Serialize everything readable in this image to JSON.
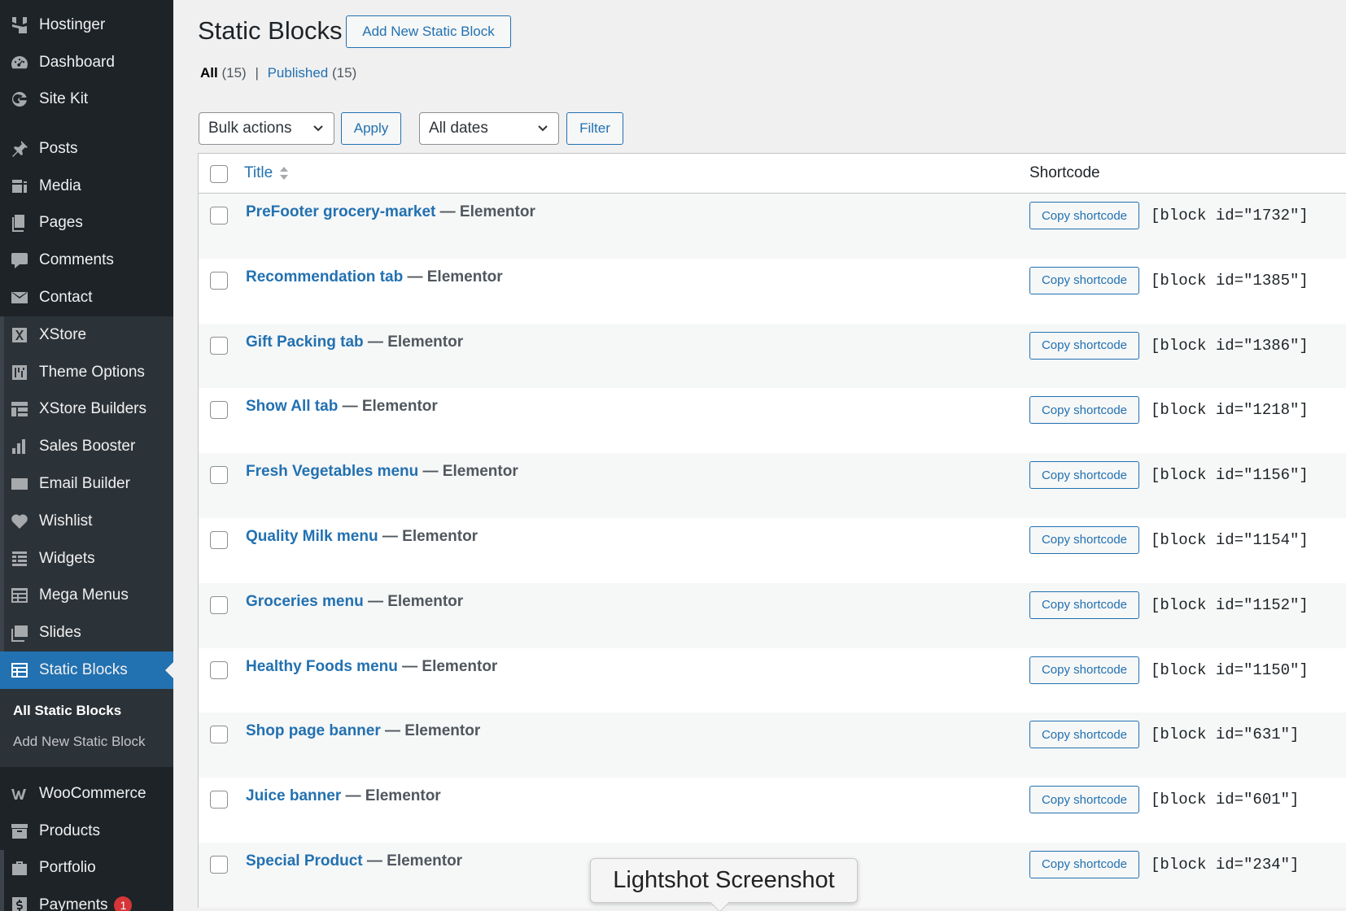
{
  "sidebar": {
    "top_items": [
      {
        "label": "Hostinger",
        "icon": "hostinger-icon"
      },
      {
        "label": "Dashboard",
        "icon": "dashboard-icon"
      },
      {
        "label": "Site Kit",
        "icon": "google-icon"
      }
    ],
    "main_items": [
      {
        "label": "Posts",
        "icon": "pin-icon"
      },
      {
        "label": "Media",
        "icon": "media-icon"
      },
      {
        "label": "Pages",
        "icon": "pages-icon"
      },
      {
        "label": "Comments",
        "icon": "comments-icon"
      },
      {
        "label": "Contact",
        "icon": "mail-icon"
      }
    ],
    "xstore_items": [
      {
        "label": "XStore",
        "icon": "xstore-icon"
      },
      {
        "label": "Theme Options",
        "icon": "theme-options-icon"
      },
      {
        "label": "XStore Builders",
        "icon": "builders-icon"
      },
      {
        "label": "Sales Booster",
        "icon": "bar-chart-icon"
      },
      {
        "label": "Email Builder",
        "icon": "envelope-icon"
      },
      {
        "label": "Wishlist",
        "icon": "heart-icon"
      },
      {
        "label": "Widgets",
        "icon": "widgets-icon"
      },
      {
        "label": "Mega Menus",
        "icon": "mega-menu-icon"
      },
      {
        "label": "Slides",
        "icon": "slides-icon"
      }
    ],
    "active_item": {
      "label": "Static Blocks",
      "icon": "static-blocks-icon"
    },
    "submenu": {
      "current": "All Static Blocks",
      "add_new": "Add New Static Block"
    },
    "bottom_items": [
      {
        "label": "WooCommerce",
        "icon": "woocommerce-icon"
      },
      {
        "label": "Products",
        "icon": "products-icon"
      },
      {
        "label": "Portfolio",
        "icon": "portfolio-icon"
      },
      {
        "label": "Payments",
        "icon": "payments-icon",
        "badge": "1"
      }
    ]
  },
  "header": {
    "title": "Static Blocks",
    "add_new_label": "Add New Static Block"
  },
  "filters": {
    "all_label": "All",
    "all_count": "(15)",
    "separator": "|",
    "published_label": "Published",
    "published_count": "(15)"
  },
  "toolbar": {
    "bulk_actions": "Bulk actions",
    "apply_label": "Apply",
    "dates": "All dates",
    "filter_label": "Filter"
  },
  "table": {
    "col_title": "Title",
    "col_shortcode": "Shortcode",
    "copy_label": "Copy shortcode",
    "rows": [
      {
        "title": "PreFooter grocery-market",
        "suffix": " — Elementor",
        "code": "[block id=\"1732\"]"
      },
      {
        "title": "Recommendation tab",
        "suffix": " — Elementor",
        "code": "[block id=\"1385\"]"
      },
      {
        "title": "Gift Packing tab",
        "suffix": " — Elementor",
        "code": "[block id=\"1386\"]"
      },
      {
        "title": "Show All tab",
        "suffix": " — Elementor",
        "code": "[block id=\"1218\"]"
      },
      {
        "title": "Fresh Vegetables menu",
        "suffix": " — Elementor",
        "code": "[block id=\"1156\"]"
      },
      {
        "title": "Quality Milk menu",
        "suffix": " — Elementor",
        "code": "[block id=\"1154\"]"
      },
      {
        "title": "Groceries menu",
        "suffix": " — Elementor",
        "code": "[block id=\"1152\"]"
      },
      {
        "title": "Healthy Foods menu",
        "suffix": " — Elementor",
        "code": "[block id=\"1150\"]"
      },
      {
        "title": "Shop page banner",
        "suffix": " — Elementor",
        "code": "[block id=\"631\"]"
      },
      {
        "title": "Juice banner",
        "suffix": " — Elementor",
        "code": "[block id=\"601\"]"
      },
      {
        "title": "Special Product",
        "suffix": " — Elementor",
        "code": "[block id=\"234\"]"
      }
    ]
  },
  "tooltip": {
    "text": "Lightshot Screenshot"
  },
  "colors": {
    "sidebar_bg": "#1d2327",
    "accent": "#2271b1",
    "page_bg": "#f0f0f1"
  }
}
